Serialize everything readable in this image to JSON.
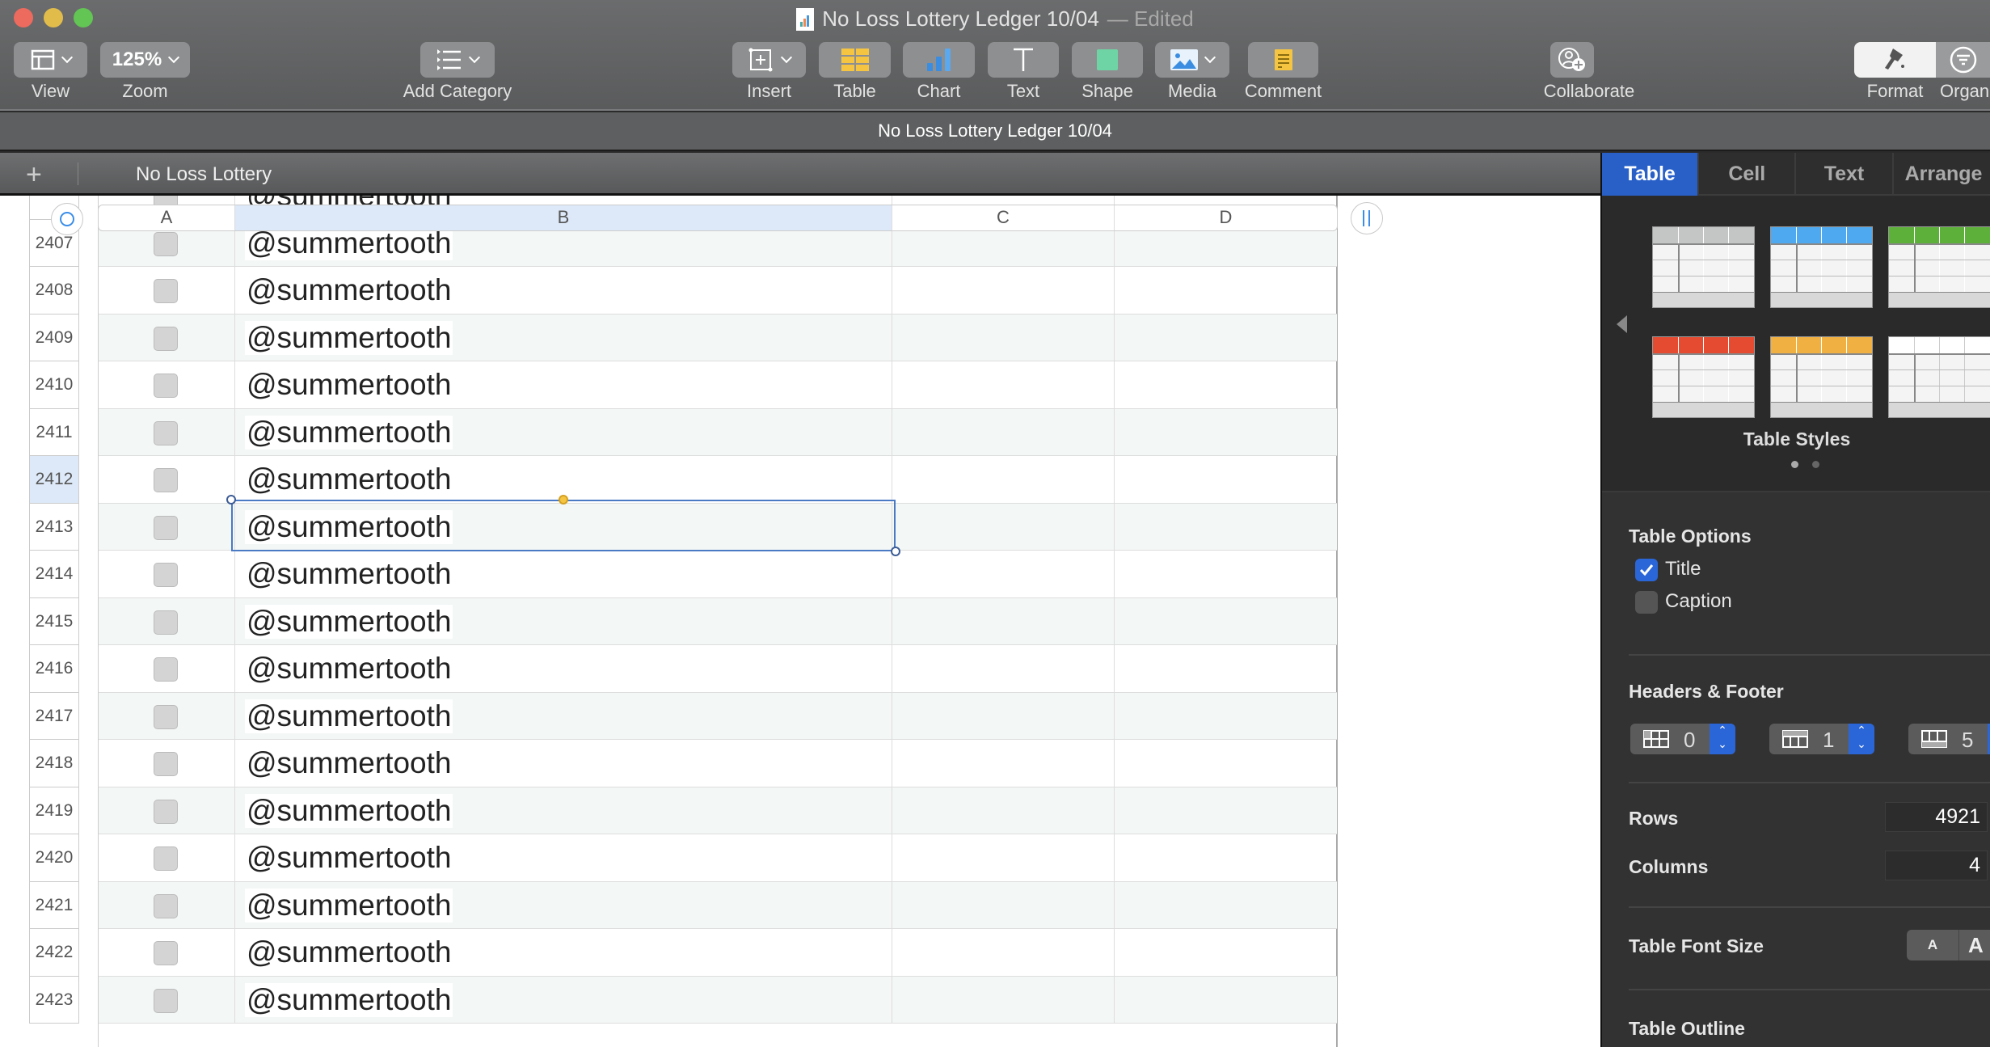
{
  "window": {
    "title": "No Loss Lottery Ledger 10/04",
    "edited_suffix": "— Edited",
    "traffic_lights": {
      "close": "#ed6a5e",
      "minimize": "#e2bc4b",
      "zoom": "#62c554"
    }
  },
  "toolbar": {
    "view": {
      "label": "View",
      "icon": "sidebar-layout-icon"
    },
    "zoom": {
      "label": "Zoom",
      "value": "125%"
    },
    "add_category": {
      "label": "Add Category",
      "icon": "list-icon"
    },
    "insert": {
      "label": "Insert",
      "icon": "insert-plus-icon"
    },
    "table": {
      "label": "Table",
      "icon": "table-icon"
    },
    "chart": {
      "label": "Chart",
      "icon": "bar-chart-icon"
    },
    "text": {
      "label": "Text",
      "icon": "T"
    },
    "shape": {
      "label": "Shape",
      "icon": "shape-icon"
    },
    "media": {
      "label": "Media",
      "icon": "image-icon"
    },
    "comment": {
      "label": "Comment",
      "icon": "note-icon"
    },
    "collaborate": {
      "label": "Collaborate",
      "icon": "add-person-icon"
    },
    "format": {
      "label": "Format",
      "icon": "paintbrush-icon"
    },
    "organize": {
      "label": "Organize",
      "icon": "filter-icon"
    }
  },
  "document_bar": {
    "title": "No Loss Lottery Ledger 10/04"
  },
  "sheet_bar": {
    "add_label": "+",
    "sheet_name": "No Loss Lottery"
  },
  "table": {
    "columns": [
      "A",
      "B",
      "C",
      "D"
    ],
    "selected_column": "B",
    "selected_row": "2412",
    "partial_top_value": "@summertooth",
    "rows": [
      {
        "num": "",
        "b": "@summertooth"
      },
      {
        "num": "2407",
        "b": "@summertooth"
      },
      {
        "num": "2408",
        "b": "@summertooth"
      },
      {
        "num": "2409",
        "b": "@summertooth"
      },
      {
        "num": "2410",
        "b": "@summertooth"
      },
      {
        "num": "2411",
        "b": "@summertooth"
      },
      {
        "num": "2412",
        "b": "@summertooth"
      },
      {
        "num": "2413",
        "b": "@summertooth"
      },
      {
        "num": "2414",
        "b": "@summertooth"
      },
      {
        "num": "2415",
        "b": "@summertooth"
      },
      {
        "num": "2416",
        "b": "@summertooth"
      },
      {
        "num": "2417",
        "b": "@summertooth"
      },
      {
        "num": "2418",
        "b": "@summertooth"
      },
      {
        "num": "2419",
        "b": "@summertooth"
      },
      {
        "num": "2420",
        "b": "@summertooth"
      },
      {
        "num": "2421",
        "b": "@summertooth"
      },
      {
        "num": "2422",
        "b": "@summertooth"
      },
      {
        "num": "2423",
        "b": "@summertooth"
      }
    ]
  },
  "sidebar": {
    "tabs": [
      "Table",
      "Cell",
      "Text",
      "Arrange"
    ],
    "active_tab": "Table",
    "table_styles": {
      "label": "Table Styles",
      "page": 1,
      "pages": 2,
      "swatches": [
        "#c4c6c6",
        "#4ea9f0",
        "#5db13a",
        "#e54b31",
        "#f1b142",
        "#ffffff"
      ]
    },
    "table_options": {
      "title": "Table Options",
      "title_checkbox": {
        "label": "Title",
        "checked": true
      },
      "caption_checkbox": {
        "label": "Caption",
        "checked": false
      }
    },
    "headers_footer": {
      "title": "Headers & Footer",
      "header_columns": "0",
      "header_rows": "1",
      "footer_rows": "5"
    },
    "rows": {
      "label": "Rows",
      "value": "4921"
    },
    "columns": {
      "label": "Columns",
      "value": "4"
    },
    "font_size": {
      "label": "Table Font Size",
      "smaller": "A",
      "larger": "A"
    },
    "outline": {
      "label": "Table Outline"
    }
  }
}
